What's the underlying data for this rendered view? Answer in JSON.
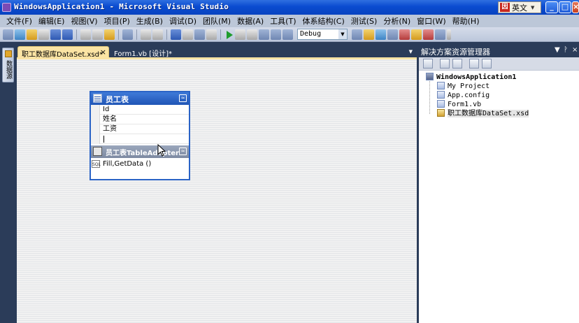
{
  "window": {
    "title": "WindowsApplication1 - Microsoft Visual Studio",
    "ime_mode": "英文",
    "ime_icon_text": "因",
    "buttons": {
      "minimize": "_",
      "maximize": "□",
      "close": "×"
    }
  },
  "menu": [
    "文件(F)",
    "编辑(E)",
    "视图(V)",
    "项目(P)",
    "生成(B)",
    "调试(D)",
    "团队(M)",
    "数据(A)",
    "工具(T)",
    "体系结构(C)",
    "测试(S)",
    "分析(N)",
    "窗口(W)",
    "帮助(H)"
  ],
  "toolbar": {
    "configuration": "Debug"
  },
  "toolbox_tab": {
    "label": "数据源"
  },
  "tabs": [
    {
      "label": "职工数据库DataSet.xsd*",
      "active": true,
      "close": "×"
    },
    {
      "label": "Form1.vb [设计]*",
      "active": false
    }
  ],
  "tab_dropdown": "▼",
  "datatable": {
    "name": "员工表",
    "collapse_glyph": "≈",
    "columns": [
      "Id",
      "姓名",
      "工资",
      ""
    ],
    "adapter_name": "员工表TableAdapter",
    "adapter_method": "Fill,GetData ()",
    "sql_icon_text": "SQL"
  },
  "solution_explorer": {
    "title": "解决方案资源管理器",
    "controls": {
      "dropdown": "▼",
      "pin": "ᚹ",
      "close": "×"
    },
    "root": "WindowsApplication1",
    "items": [
      "My Project",
      "App.config",
      "Form1.vb",
      "职工数据库DataSet.xsd"
    ]
  }
}
